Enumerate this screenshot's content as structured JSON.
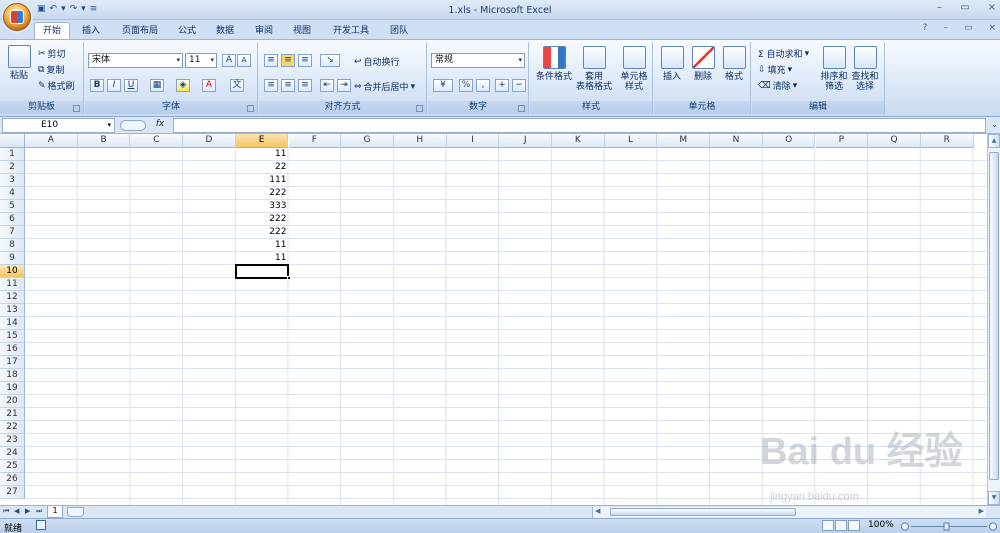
{
  "window": {
    "title": "1.xls - Microsoft Excel",
    "controls": [
      "–",
      "▭",
      "×"
    ]
  },
  "tabs": [
    "开始",
    "插入",
    "页面布局",
    "公式",
    "数据",
    "审阅",
    "视图",
    "开发工具",
    "团队"
  ],
  "ribbon": {
    "clipboard": {
      "paste": "粘贴",
      "cut": "剪切",
      "copy": "复制",
      "format_painter": "格式刷",
      "label": "剪贴板"
    },
    "font": {
      "font_name": "宋体",
      "font_size": "11",
      "label": "字体",
      "grow": "A",
      "shrink": "A",
      "bold": "B",
      "italic": "I",
      "underline": "U",
      "font_color": "A"
    },
    "alignment": {
      "wrap": "自动换行",
      "merge": "合并后居中",
      "label": "对齐方式"
    },
    "number": {
      "format": "常规",
      "percent": "%",
      "label": "数字"
    },
    "styles": {
      "conditional": "条件格式",
      "table": "套用\n表格格式",
      "cell_styles": "单元格\n样式",
      "label": "样式"
    },
    "cells": {
      "insert": "插入",
      "delete": "删除",
      "format": "格式",
      "label": "单元格"
    },
    "editing": {
      "autosum": "Σ 自动求和",
      "fill": "填充",
      "clear": "清除",
      "sort": "排序和\n筛选",
      "find": "查找和\n选择",
      "label": "编辑"
    }
  },
  "formula_bar": {
    "name_box": "E10",
    "fx": "fx",
    "value": ""
  },
  "sheet": {
    "columns": [
      "A",
      "B",
      "C",
      "D",
      "E",
      "F",
      "G",
      "H",
      "I",
      "J",
      "K",
      "L",
      "M",
      "N",
      "O",
      "P",
      "Q",
      "R"
    ],
    "rows": [
      "1",
      "2",
      "3",
      "4",
      "5",
      "6",
      "7",
      "8",
      "9",
      "10",
      "11",
      "12",
      "13",
      "14",
      "15",
      "16",
      "17",
      "18",
      "19",
      "20",
      "21",
      "22",
      "23",
      "24",
      "25",
      "26",
      "27"
    ],
    "values_column_e": [
      "11",
      "22",
      "111",
      "222",
      "333",
      "222",
      "222",
      "11",
      "11"
    ],
    "selected_cell": "E10"
  },
  "sheet_tabs": {
    "active": "1"
  },
  "status": {
    "mode": "就绪",
    "zoom": "100%"
  },
  "watermark": {
    "brand": "Bai du 经验",
    "url": "jingyan.baidu.com"
  }
}
